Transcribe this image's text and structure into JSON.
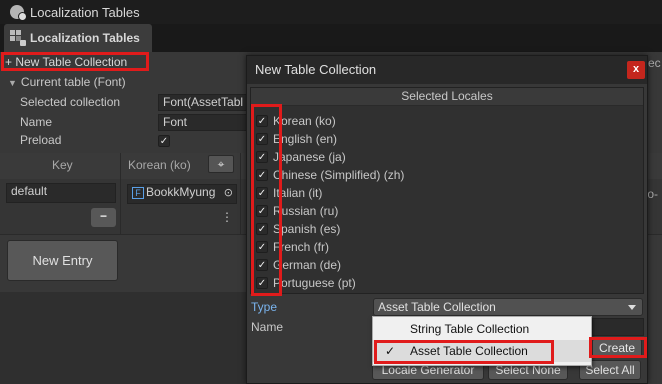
{
  "window": {
    "title": "Localization Tables",
    "tab_label": "Localization Tables"
  },
  "editor": {
    "new_collection_label": "+ New Table Collection",
    "current_table_label": "Current table (Font)",
    "selected_collection_label": "Selected collection",
    "selected_collection_value": "Font(AssetTabl",
    "name_label": "Name",
    "name_value": "Font",
    "preload_label": "Preload",
    "preload_checked": "✓",
    "columns": {
      "key": "Key",
      "korean": "Korean (ko)"
    },
    "row_key": "default",
    "row_obj": "BookkMyung",
    "minus_label": "−",
    "new_entry_label": "New Entry",
    "partial_right_1": "ec",
    "partial_right_2": "t)",
    "partial_right_3": "to-"
  },
  "dialog": {
    "title": "New Table Collection",
    "close_label": "x",
    "selected_locales_header": "Selected Locales",
    "locales": [
      {
        "label": "Korean (ko)",
        "checked": "✓"
      },
      {
        "label": "English (en)",
        "checked": "✓"
      },
      {
        "label": "Japanese (ja)",
        "checked": "✓"
      },
      {
        "label": "Chinese (Simplified) (zh)",
        "checked": "✓"
      },
      {
        "label": "Italian (it)",
        "checked": "✓"
      },
      {
        "label": "Russian (ru)",
        "checked": "✓"
      },
      {
        "label": "Spanish (es)",
        "checked": "✓"
      },
      {
        "label": "French (fr)",
        "checked": "✓"
      },
      {
        "label": "German (de)",
        "checked": "✓"
      },
      {
        "label": "Portuguese (pt)",
        "checked": "✓"
      }
    ],
    "type_label": "Type",
    "name_label": "Name",
    "type_value": "Asset Table Collection",
    "type_options": [
      {
        "label": "String Table Collection",
        "checked": ""
      },
      {
        "label": "Asset Table Collection",
        "checked": "✓"
      }
    ],
    "create_label": "Create",
    "locale_generator_label": "Locale Generator",
    "select_none_label": "Select None",
    "select_all_label": "Select All"
  },
  "colors": {
    "highlight_red": "#e01b1b",
    "close_red": "#c4261d",
    "type_blue": "#7ab4ee"
  }
}
